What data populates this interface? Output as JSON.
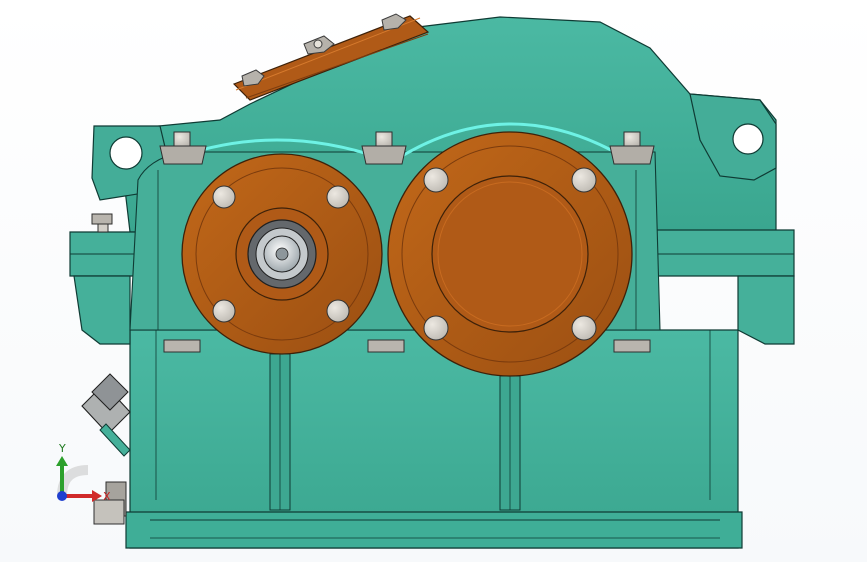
{
  "triad": {
    "x_label": "X",
    "y_label": "Y",
    "colors": {
      "x": "#d12a2a",
      "y": "#2ca02c",
      "z": "#1f3fcf"
    }
  },
  "colors": {
    "housing": "#44ad98",
    "housing_shadow": "#2a7e6f",
    "edge": "#0f3b34",
    "flange": "#b05a17",
    "flange_highlight": "#c86b20",
    "bolt_head": "#c7c3bb",
    "bolt_dark": "#8b8882",
    "highlight_cyan": "#6ef2e5"
  }
}
